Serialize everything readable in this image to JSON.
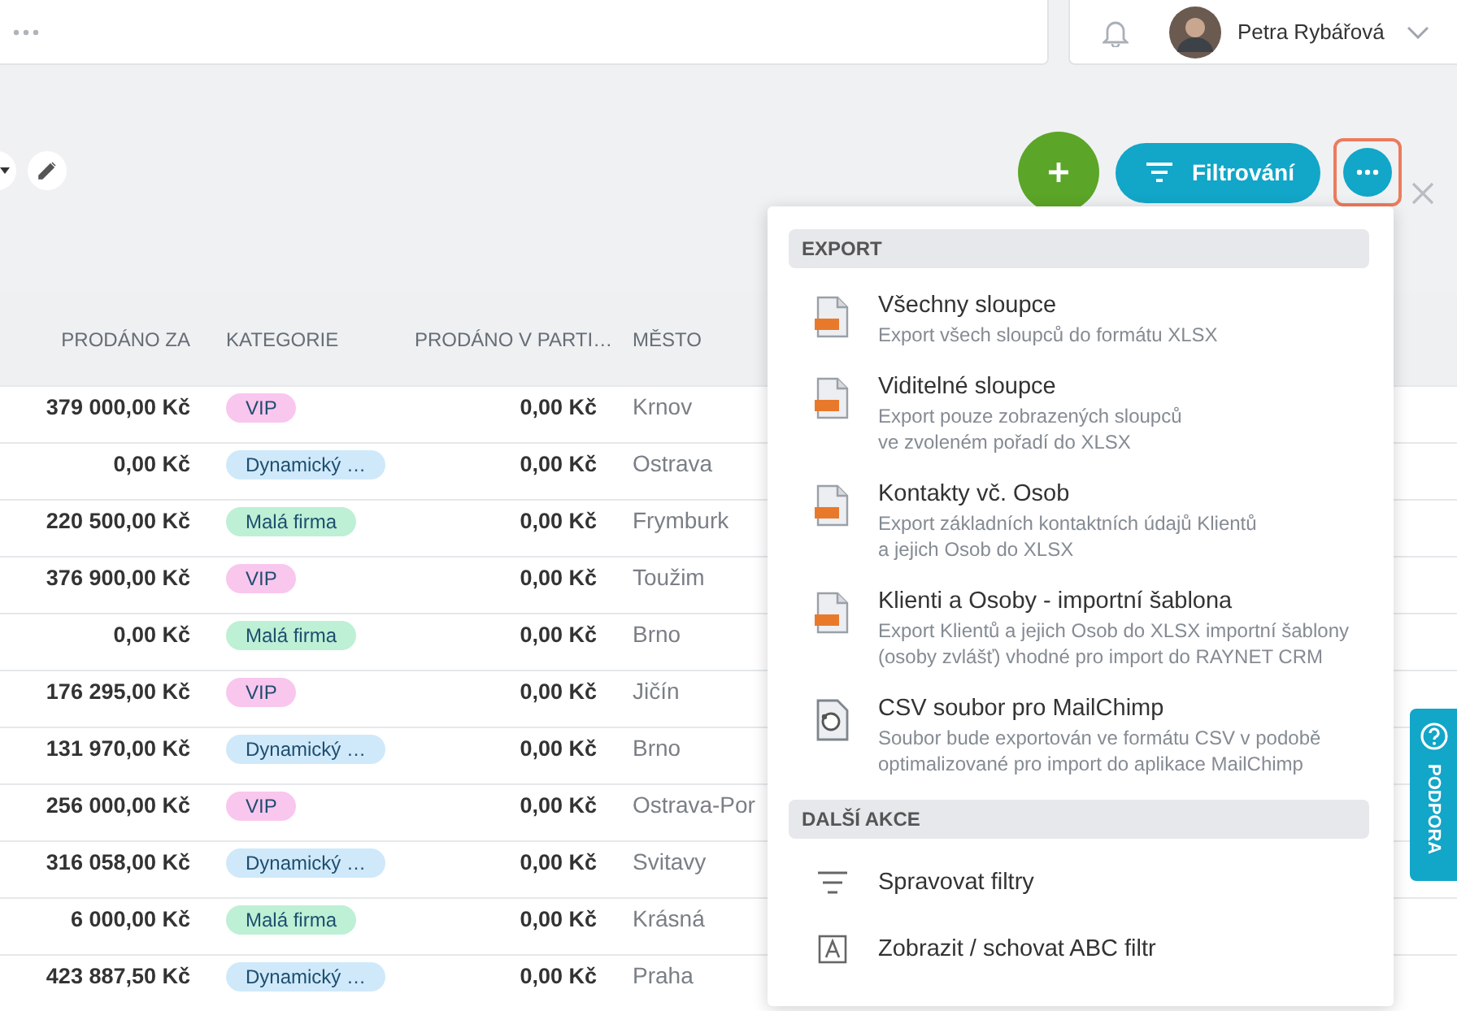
{
  "top_bar": {
    "user": {
      "name": "Petra Rybářová"
    }
  },
  "toolbar": {
    "filter_button": {
      "label": "Filtrování"
    },
    "more_button": {
      "selected": true
    }
  },
  "table": {
    "columns": [
      "PRODÁNO ZA",
      "KATEGORIE",
      "PRODÁNO V PARTI…",
      "MĚSTO"
    ],
    "rows": [
      {
        "sold_for": "379 000,00 Kč",
        "category": {
          "label": "VIP",
          "color": "#f9c6ee"
        },
        "sold_partial": "0,00 Kč",
        "city": "Krnov"
      },
      {
        "sold_for": "0,00 Kč",
        "category": {
          "label": "Dynamický …",
          "color": "#cfe9fa"
        },
        "sold_partial": "0,00 Kč",
        "city": "Ostrava"
      },
      {
        "sold_for": "220 500,00 Kč",
        "category": {
          "label": "Malá firma",
          "color": "#bdf0d5"
        },
        "sold_partial": "0,00 Kč",
        "city": "Frymburk"
      },
      {
        "sold_for": "376 900,00 Kč",
        "category": {
          "label": "VIP",
          "color": "#f9c6ee"
        },
        "sold_partial": "0,00 Kč",
        "city": "Toužim"
      },
      {
        "sold_for": "0,00 Kč",
        "category": {
          "label": "Malá firma",
          "color": "#bdf0d5"
        },
        "sold_partial": "0,00 Kč",
        "city": "Brno"
      },
      {
        "sold_for": "176 295,00 Kč",
        "category": {
          "label": "VIP",
          "color": "#f9c6ee"
        },
        "sold_partial": "0,00 Kč",
        "city": "Jičín"
      },
      {
        "sold_for": "131 970,00 Kč",
        "category": {
          "label": "Dynamický …",
          "color": "#cfe9fa"
        },
        "sold_partial": "0,00 Kč",
        "city": "Brno"
      },
      {
        "sold_for": "256 000,00 Kč",
        "category": {
          "label": "VIP",
          "color": "#f9c6ee"
        },
        "sold_partial": "0,00 Kč",
        "city": "Ostrava-Por"
      },
      {
        "sold_for": "316 058,00 Kč",
        "category": {
          "label": "Dynamický …",
          "color": "#cfe9fa"
        },
        "sold_partial": "0,00 Kč",
        "city": "Svitavy"
      },
      {
        "sold_for": "6 000,00 Kč",
        "category": {
          "label": "Malá firma",
          "color": "#bdf0d5"
        },
        "sold_partial": "0,00 Kč",
        "city": "Krásná"
      },
      {
        "sold_for": "423 887,50 Kč",
        "category": {
          "label": "Dynamický …",
          "color": "#cfe9fa"
        },
        "sold_partial": "0,00 Kč",
        "city": "Praha"
      }
    ]
  },
  "menu": {
    "sections": [
      {
        "title": "EXPORT",
        "items": [
          {
            "kind": "xls",
            "title": "Všechny sloupce",
            "description": "Export všech sloupců do formátu XLSX"
          },
          {
            "kind": "xls",
            "title": "Viditelné sloupce",
            "description": "Export pouze zobrazených sloupců\nve zvoleném pořadí do XLSX"
          },
          {
            "kind": "xls",
            "title": "Kontakty vč. Osob",
            "description": "Export základních kontaktních údajů Klientů\na jejich Osob do XLSX"
          },
          {
            "kind": "xls",
            "title": "Klienti a Osoby - importní šablona",
            "description": "Export Klientů a jejich Osob do XLSX importní šablony\n(osoby zvlášť) vhodné pro import do RAYNET CRM"
          },
          {
            "kind": "mailchimp",
            "title": "CSV soubor pro MailChimp",
            "description": "Soubor bude exportován ve formátu CSV v podobě\noptimalizované pro import do aplikace MailChimp"
          }
        ]
      },
      {
        "title": "DALŠÍ AKCE",
        "items": [
          {
            "kind": "filter",
            "title": "Spravovat filtry"
          },
          {
            "kind": "abc",
            "title": "Zobrazit / schovat ABC filtr"
          }
        ]
      }
    ]
  },
  "support_tab": {
    "label": "PODPORA"
  }
}
